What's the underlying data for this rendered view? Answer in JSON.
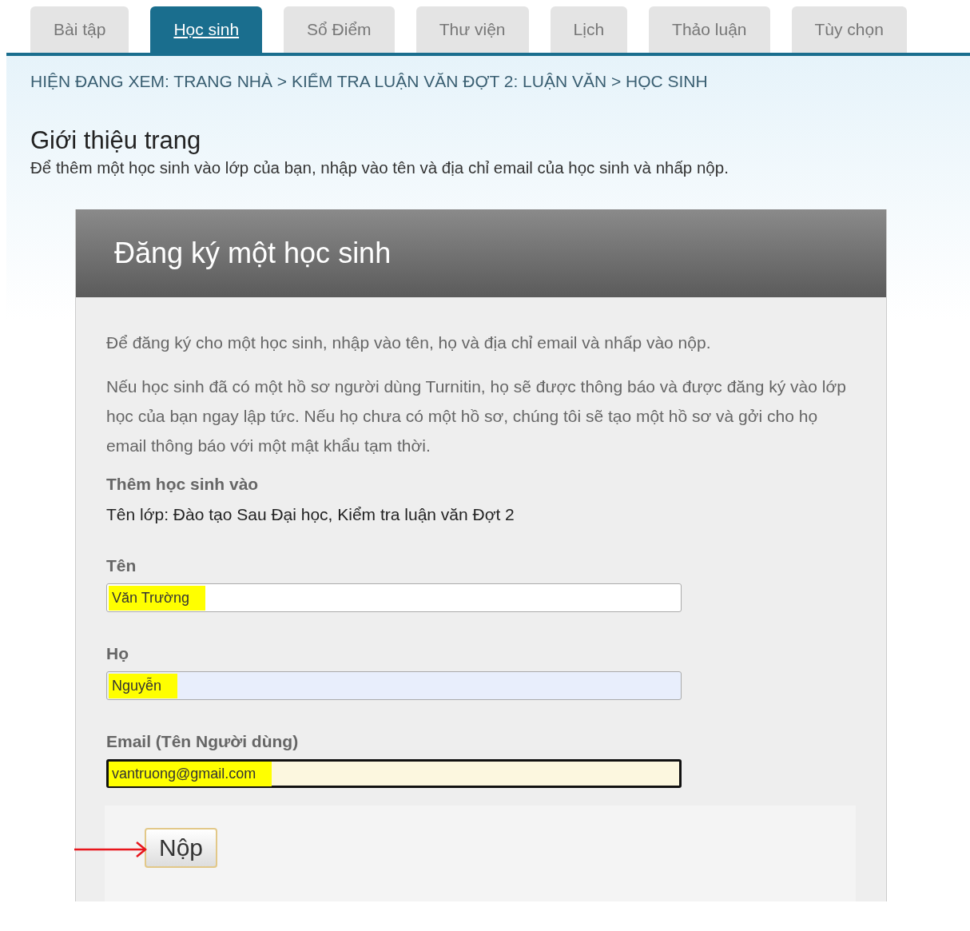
{
  "tabs": [
    {
      "label": "Bài tập",
      "selected": false
    },
    {
      "label": "Học sinh",
      "selected": true
    },
    {
      "label": "Sổ Điểm",
      "selected": false
    },
    {
      "label": "Thư viện",
      "selected": false
    },
    {
      "label": "Lịch",
      "selected": false
    },
    {
      "label": "Thảo luận",
      "selected": false
    },
    {
      "label": "Tùy chọn",
      "selected": false
    }
  ],
  "breadcrumb": "HIỆN ĐANG XEM: TRANG NHÀ > KIỂM TRA LUẬN VĂN ĐỢT 2: LUẬN VĂN > HỌC SINH",
  "intro": {
    "title": "Giới thiệu trang",
    "text": "Để thêm một học sinh vào lớp của bạn, nhập vào tên và địa chỉ email của học sinh và nhấp nộp."
  },
  "form": {
    "title": "Đăng ký một học sinh",
    "paragraphs": [
      "Để đăng ký cho một học sinh, nhập vào tên, họ và địa chỉ email và nhấp vào nộp.",
      "Nếu học sinh đã có một hồ sơ người dùng Turnitin, họ sẽ được thông báo và được đăng ký vào lớp học của bạn ngay lập tức. Nếu họ chưa có một hồ sơ, chúng tôi sẽ tạo một hồ sơ và gởi cho họ email thông báo với một mật khẩu tạm thời."
    ],
    "class_heading": "Thêm học sinh vào",
    "class_name": "Tên lớp: Đào tạo Sau Đại học, Kiểm tra luận văn Đợt 2",
    "fields": [
      {
        "label": "Tên",
        "value": "Văn Trường",
        "highlighted": true,
        "autofilled": false,
        "focused": false
      },
      {
        "label": "Họ",
        "value": "Nguyễn",
        "highlighted": true,
        "autofilled": true,
        "focused": false
      },
      {
        "label": "Email (Tên Người dùng)",
        "value": "vantruong@gmail.com",
        "highlighted": true,
        "autofilled": false,
        "focused": true
      }
    ],
    "submit": "Nộp"
  }
}
